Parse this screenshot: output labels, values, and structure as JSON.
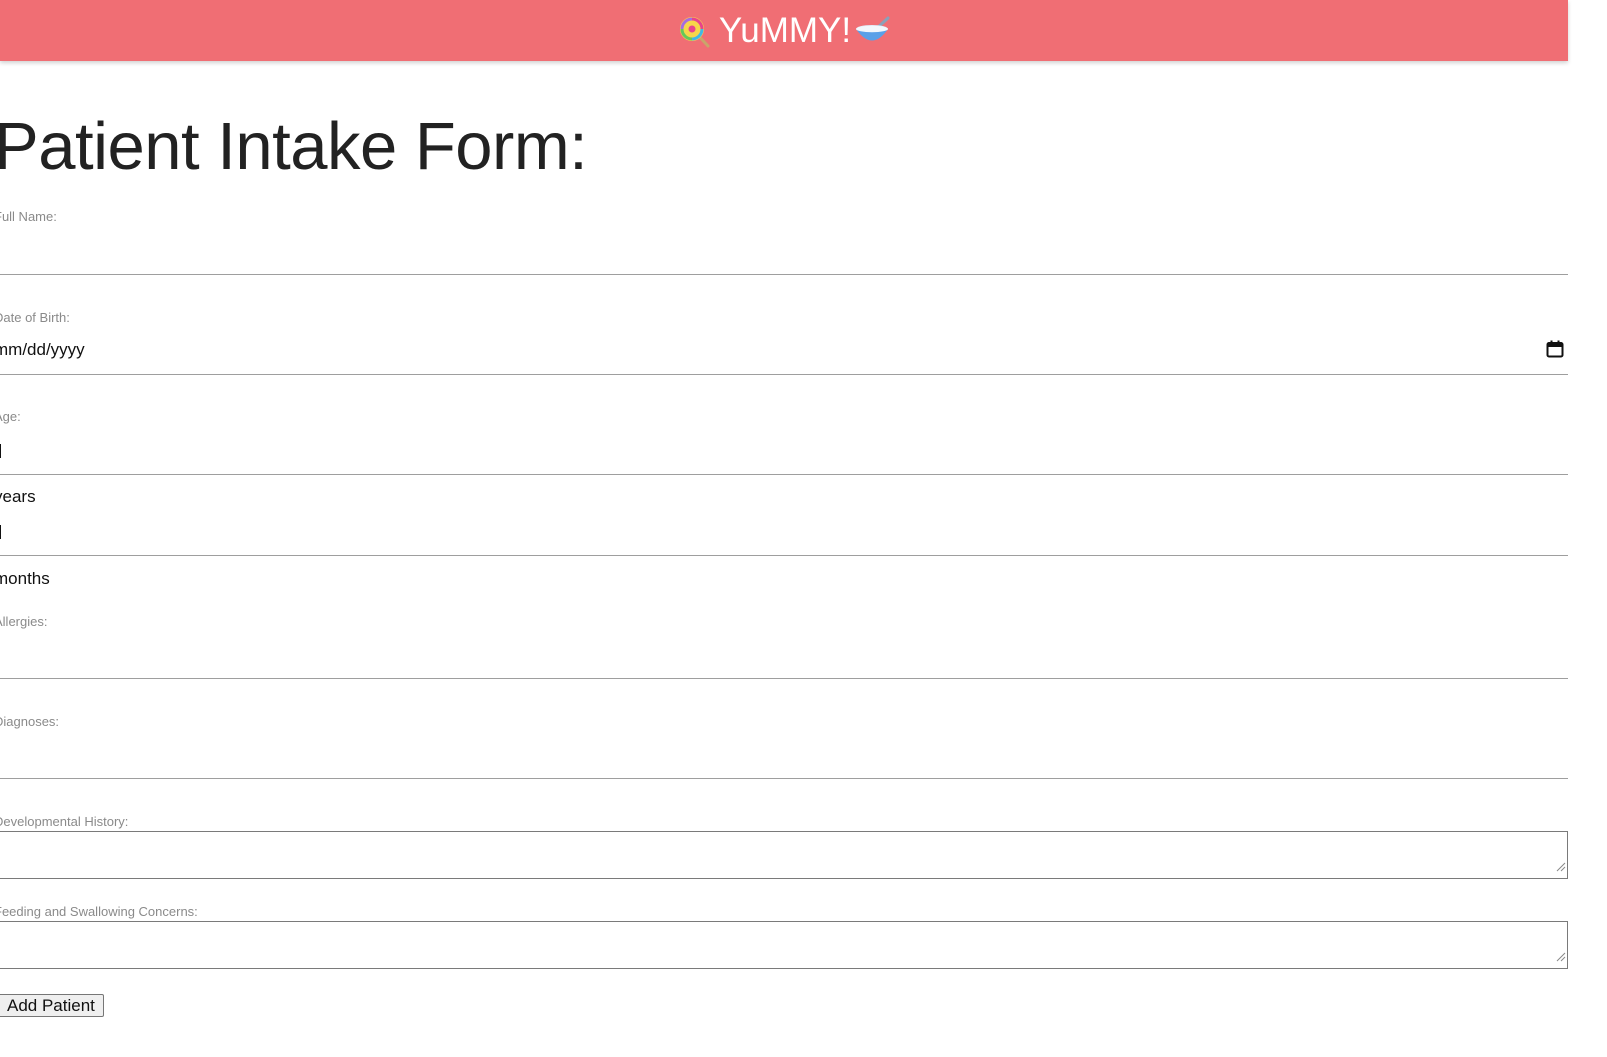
{
  "header": {
    "brand_text": "YuMMY!",
    "left_icon": "lollipop-icon",
    "right_icon": "bowl-with-spoon-icon",
    "background_color": "#f06e74"
  },
  "form": {
    "title": "Patient Intake Form:",
    "full_name": {
      "label": "Full Name:",
      "value": ""
    },
    "date_of_birth": {
      "label": "Date of Birth:",
      "placeholder": "mm/dd/yyyy"
    },
    "age": {
      "label": "Age:",
      "years_value": "",
      "years_unit": "years",
      "months_value": "",
      "months_unit": "months"
    },
    "allergies": {
      "label": "Allergies:",
      "value": ""
    },
    "diagnoses": {
      "label": "Diagnoses:",
      "value": ""
    },
    "developmental_history": {
      "label": "Developmental History:",
      "value": ""
    },
    "feeding_swallowing": {
      "label": "Feeding and Swallowing Concerns:",
      "value": ""
    },
    "submit_label": "Add Patient"
  }
}
